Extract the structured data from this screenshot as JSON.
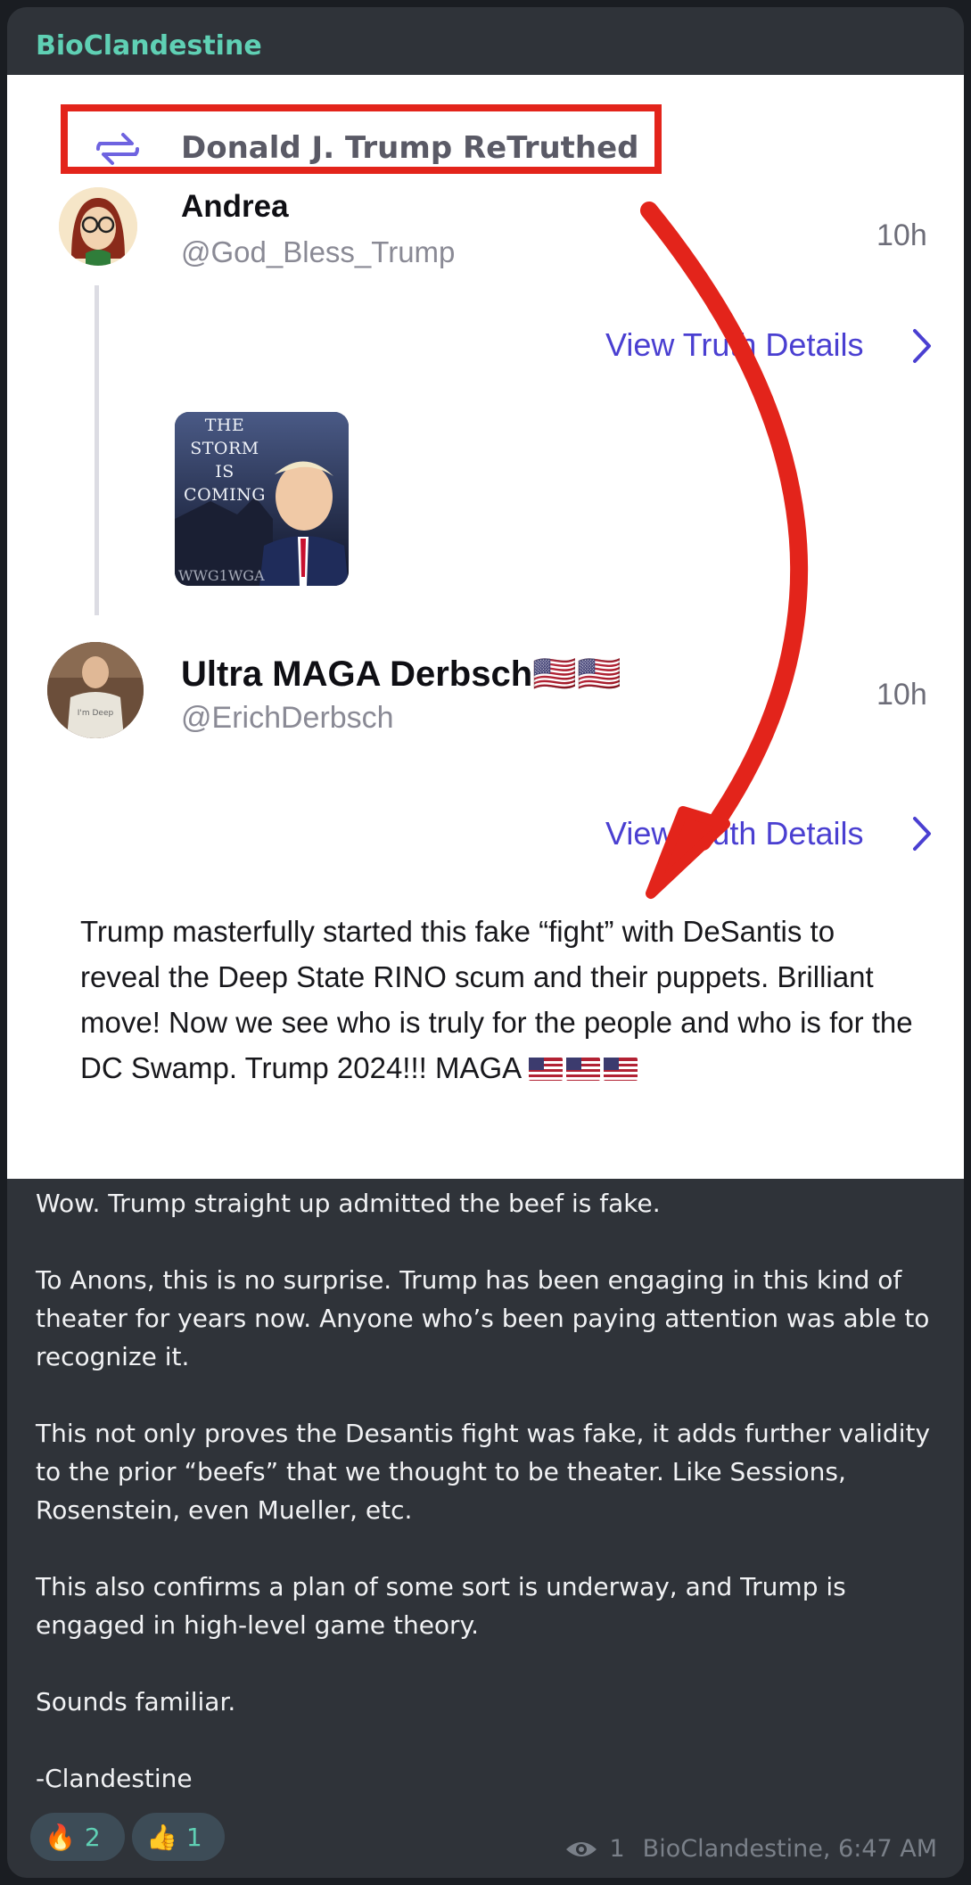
{
  "channel": {
    "name": "BioClandestine"
  },
  "screenshot": {
    "retruth": {
      "label": "Donald J. Trump ReTruthed"
    },
    "posts": [
      {
        "name": "Andrea",
        "handle": "@God_Bless_Trump",
        "time": "10h",
        "link": "View Truth Details"
      },
      {
        "name": "Ultra MAGA Derbsch🇺🇸🇺🇸",
        "handle": "@ErichDerbsch",
        "time": "10h",
        "link": "View Truth Details"
      }
    ],
    "thumb": {
      "line1": "THE",
      "line2": "STORM",
      "line3": "IS",
      "line4": "COMING",
      "bottom": "WWG1WGA"
    },
    "body": "Trump masterfully started this fake “fight” with DeSantis to reveal the Deep State RINO scum and their puppets. Brilliant move! Now we see who is truly for the people and who is for the DC Swamp. Trump 2024!!! MAGA",
    "arrow_color": "#e3241b"
  },
  "caption": {
    "p1": "Wow. Trump straight up admitted the beef is fake.",
    "p2": "To Anons, this is no surprise. Trump has been engaging in this kind of theater for years now. Anyone who’s been paying attention was able to recognize it.",
    "p3": "This not only proves the Desantis fight was fake, it adds further validity to the prior “beefs” that we thought to be theater. Like Sessions, Rosenstein, even Mueller, etc.",
    "p4": "This also confirms a plan of some sort is underway, and Trump is engaged in high-level game theory.",
    "p5": "Sounds familiar.",
    "p6": "-Clandestine"
  },
  "reactions": [
    {
      "emoji": "🔥",
      "icon": "fire-icon",
      "count": "2"
    },
    {
      "emoji": "👍",
      "icon": "thumbs-up-icon",
      "count": "1"
    }
  ],
  "footer": {
    "views": "1",
    "signature": "BioClandestine, 6:47 AM"
  },
  "colors": {
    "accent": "#5fd0b4",
    "link": "#4a3fd1",
    "bubble": "#2f3339"
  }
}
